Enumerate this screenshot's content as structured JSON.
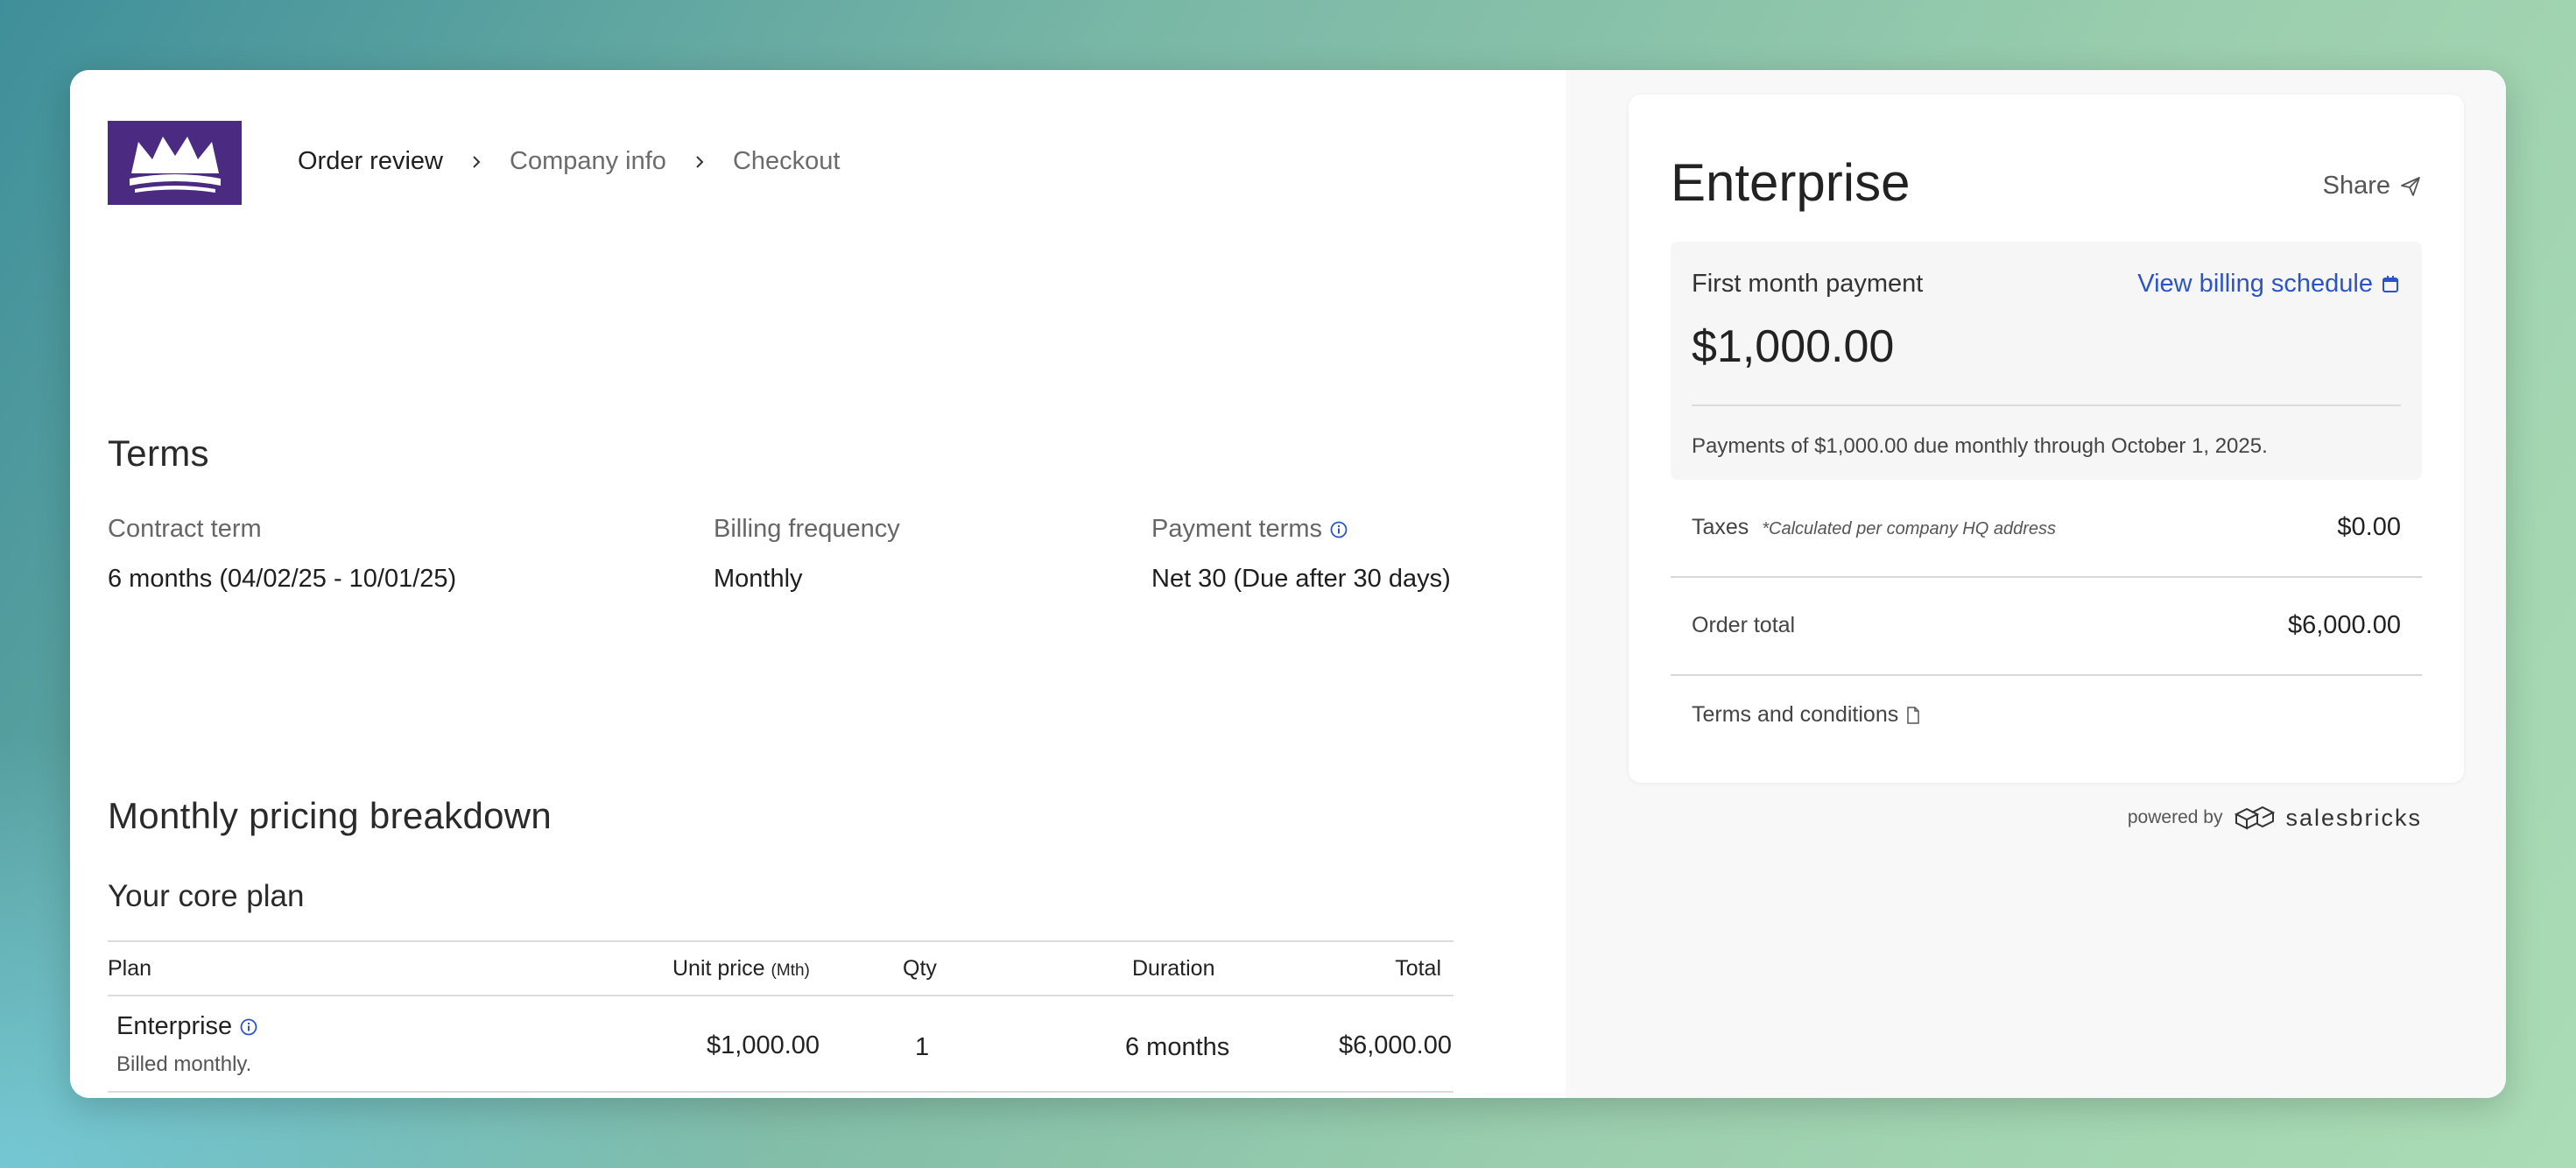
{
  "header": {
    "breadcrumb": [
      "Order review",
      "Company info",
      "Checkout"
    ]
  },
  "terms": {
    "title": "Terms",
    "contract_term_label": "Contract term",
    "contract_term_value": "6 months (04/02/25 - 10/01/25)",
    "billing_frequency_label": "Billing frequency",
    "billing_frequency_value": "Monthly",
    "payment_terms_label": "Payment terms",
    "payment_terms_value": "Net 30 (Due after 30 days)"
  },
  "pricing": {
    "title": "Monthly pricing breakdown",
    "subtitle": "Your core plan",
    "columns": {
      "plan": "Plan",
      "unit_price": "Unit price",
      "unit_price_suffix": "(Mth)",
      "qty": "Qty",
      "duration": "Duration",
      "total": "Total"
    },
    "row": {
      "plan": "Enterprise",
      "plan_note": "Billed monthly.",
      "unit_price": "$1,000.00",
      "qty": "1",
      "duration": "6 months",
      "total": "$6,000.00"
    }
  },
  "summary": {
    "plan_name": "Enterprise",
    "share_label": "Share",
    "first_payment_label": "First month payment",
    "billing_schedule_link": "View billing schedule",
    "first_payment_amount": "$1,000.00",
    "payment_note": "Payments of $1,000.00 due monthly through October 1, 2025.",
    "taxes_label": "Taxes",
    "taxes_note": "*Calculated per company HQ address",
    "taxes_value": "$0.00",
    "order_total_label": "Order total",
    "order_total_value": "$6,000.00",
    "terms_link": "Terms and conditions"
  },
  "footer": {
    "powered_by": "powered by",
    "brand": "salesbricks"
  },
  "colors": {
    "logo_bg": "#4b2a82",
    "link": "#2b55c7"
  }
}
